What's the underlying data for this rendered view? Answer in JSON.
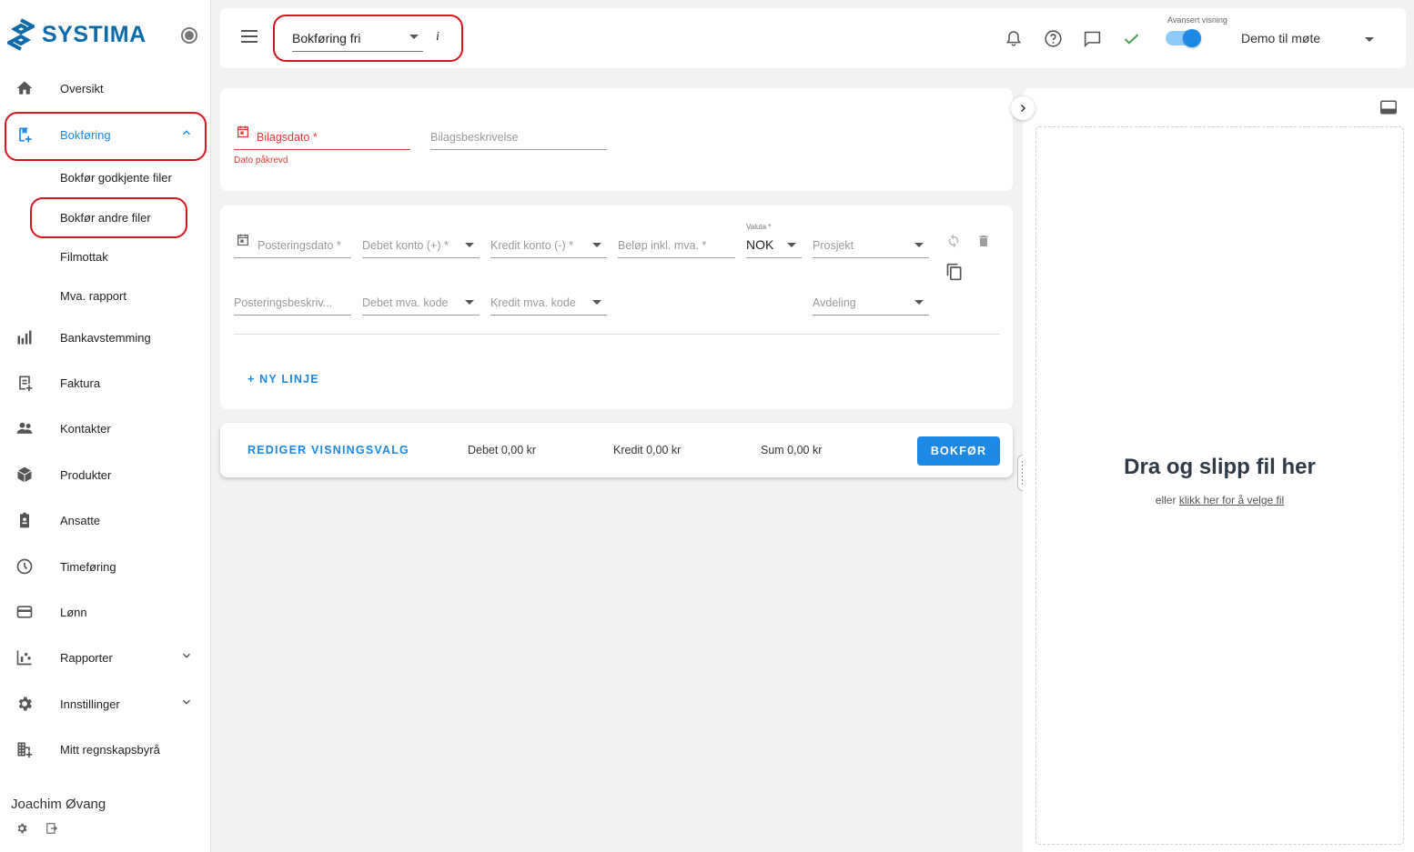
{
  "app": {
    "brand": "SYSTIMA",
    "brand_color": "#0f6aaa",
    "accent": "#1e88e5",
    "error": "#e53935"
  },
  "sidebar": {
    "items": [
      {
        "label": "Oversikt",
        "icon": "home-icon"
      },
      {
        "label": "Bokføring",
        "icon": "bookkeeping-icon",
        "active": true
      },
      {
        "label": "Bankavstemming",
        "icon": "bank-icon"
      },
      {
        "label": "Faktura",
        "icon": "invoice-icon"
      },
      {
        "label": "Kontakter",
        "icon": "contacts-icon"
      },
      {
        "label": "Produkter",
        "icon": "box-icon"
      },
      {
        "label": "Ansatte",
        "icon": "badge-icon"
      },
      {
        "label": "Timeføring",
        "icon": "clock-icon"
      },
      {
        "label": "Lønn",
        "icon": "card-icon"
      },
      {
        "label": "Rapporter",
        "icon": "reports-icon"
      },
      {
        "label": "Innstillinger",
        "icon": "gear-icon"
      },
      {
        "label": "Mitt regnskapsbyrå",
        "icon": "building-icon"
      }
    ],
    "sub_items": [
      "Bokfør godkjente filer",
      "Bokfør andre filer",
      "Filmottak",
      "Mva. rapport"
    ],
    "user": "Joachim Øvang"
  },
  "topbar": {
    "selector_value": "Bokføring fri",
    "info": "i",
    "advanced_label": "Avansert visning",
    "advanced_on": true,
    "company": "Demo til møte"
  },
  "voucher": {
    "date_label": "Bilagsdato *",
    "date_error": "Dato påkrevd",
    "description_label": "Bilagsbeskrivelse"
  },
  "lines": {
    "posting_date": "Posteringsdato *",
    "debit_account": "Debet konto (+) *",
    "credit_account": "Kredit konto (-) *",
    "amount": "Beløp inkl. mva. *",
    "currency_label": "Valuta *",
    "currency_value": "NOK",
    "project": "Prosjekt",
    "posting_desc": "Posteringsbeskriv...",
    "debit_vat": "Debet mva. kode",
    "credit_vat": "Kredit mva. kode",
    "department": "Avdeling",
    "new_line": "+ NY LINJE"
  },
  "footer": {
    "edit_view": "REDIGER VISNINGSVALG",
    "debit_sum": "Debet 0,00 kr",
    "credit_sum": "Kredit 0,00 kr",
    "total_sum": "Sum 0,00 kr",
    "submit": "BOKFØR"
  },
  "dropzone": {
    "title": "Dra og slipp fil her",
    "prefix": "eller",
    "link": "klikk her for å velge fil"
  }
}
